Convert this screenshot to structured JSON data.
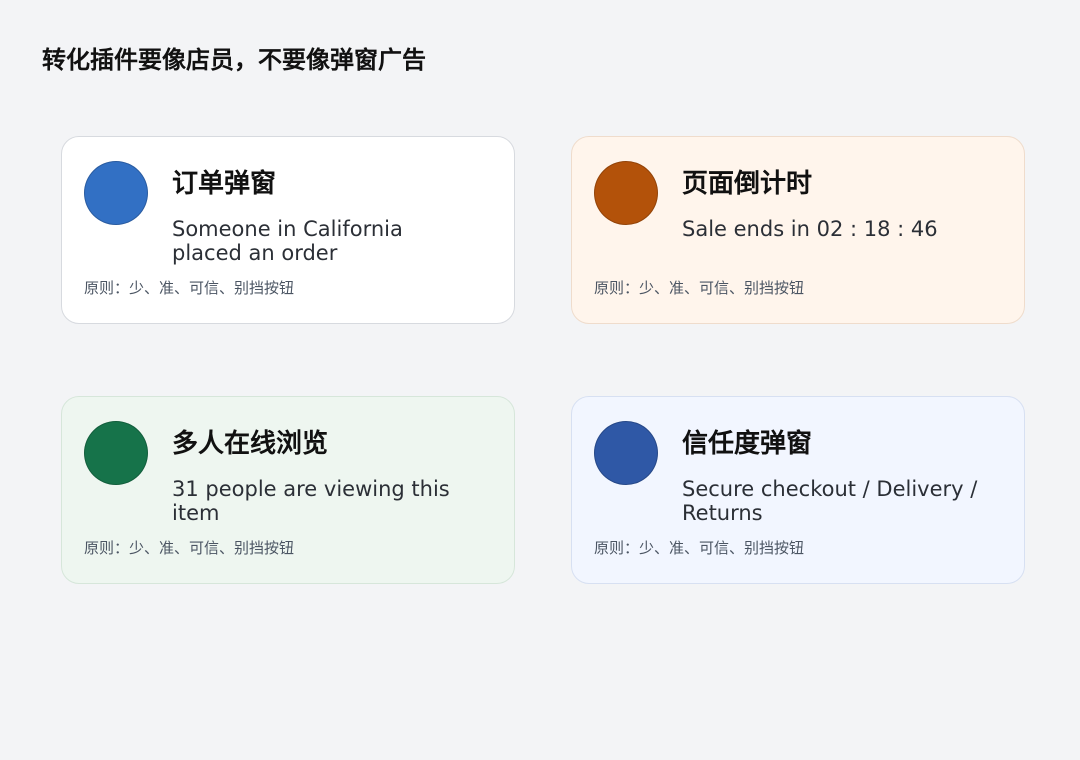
{
  "title": "转化插件要像店员，不要像弹窗广告",
  "cards": [
    {
      "title": "订单弹窗",
      "text": "Someone in California placed an order",
      "note": "原则：少、准、可信、别挡按钮",
      "circle_color": "#3270c4",
      "background": "#ffffff",
      "icon_name": "circle-icon"
    },
    {
      "title": "页面倒计时",
      "text": "Sale ends in 02 : 18 : 46",
      "note": "原则：少、准、可信、别挡按钮",
      "circle_color": "#b3520a",
      "background": "#fff5ec",
      "icon_name": "circle-icon"
    },
    {
      "title": "多人在线浏览",
      "text": "31 people are viewing this item",
      "note": "原则：少、准、可信、别挡按钮",
      "circle_color": "#16734a",
      "background": "#eef6f0",
      "icon_name": "circle-icon"
    },
    {
      "title": "信任度弹窗",
      "text": "Secure checkout / Delivery / Returns",
      "note": "原则：少、准、可信、别挡按钮",
      "circle_color": "#2f58a6",
      "background": "#f2f6ff",
      "icon_name": "circle-icon"
    }
  ]
}
